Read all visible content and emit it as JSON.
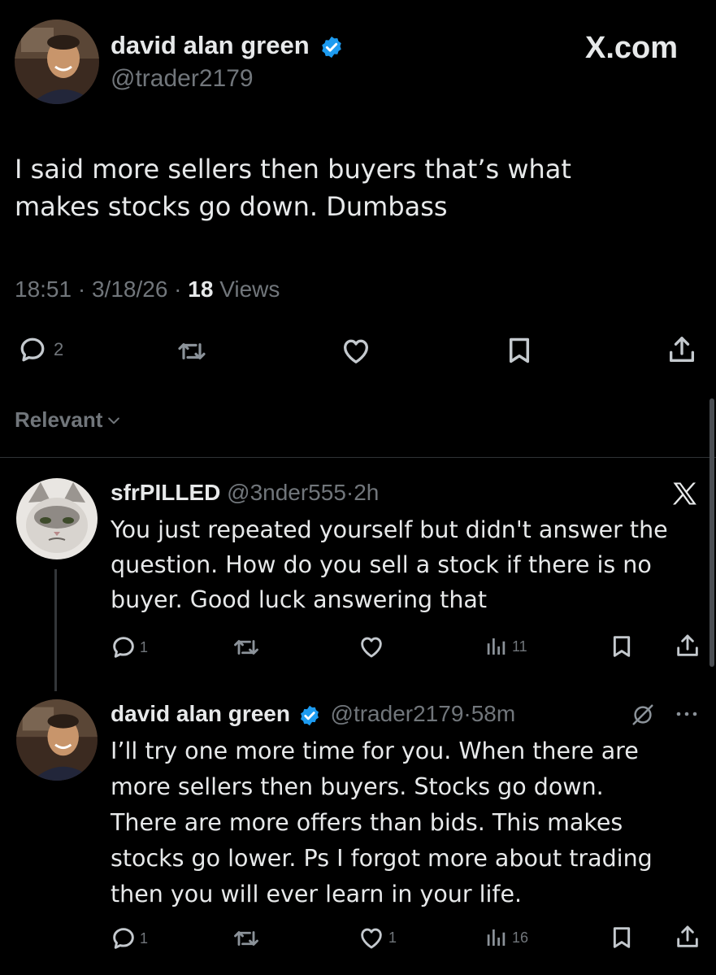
{
  "main_tweet": {
    "author_name": "david alan green",
    "handle": "@trader2179",
    "brand": "X.com",
    "text_lines": [
      "I said more sellers then buyers that’s what",
      "makes stocks go down.  Dumbass"
    ],
    "time": "18:51",
    "date": "3/18/26",
    "views_count": "18",
    "views_label": "Views",
    "sep": "·",
    "reply_count": "2"
  },
  "sort": {
    "label": "Relevant"
  },
  "replies": [
    {
      "author_name": "sfrPILLED",
      "handle": "@3nder555",
      "age": "2h",
      "text_lines": [
        "You just repeated yourself but didn't answer the",
        "question. How do you sell a stock if there is no",
        "buyer. Good luck answering that"
      ],
      "reply_count": "1",
      "views_count": "11"
    },
    {
      "author_name": "david alan green",
      "handle": "@trader2179",
      "age": "58m",
      "text_lines": [
        "I’ll try one more time for you.  When there are",
        "more sellers then buyers. Stocks go down.",
        "There are more offers than bids. This makes",
        "stocks go lower. Ps I forgot more about trading",
        "then you will ever learn in your life."
      ],
      "reply_count": "1",
      "like_count": "1",
      "views_count": "16"
    }
  ],
  "colors": {
    "background": "#000000",
    "text": "#e7e9ea",
    "muted": "#71767b",
    "verified": "#1d9bf0"
  },
  "icons": [
    "reply-icon",
    "retweet-icon",
    "like-icon",
    "bookmark-icon",
    "share-icon",
    "views-icon",
    "x-logo-icon",
    "grok-icon",
    "more-icon",
    "chevron-down-icon",
    "verified-icon"
  ]
}
